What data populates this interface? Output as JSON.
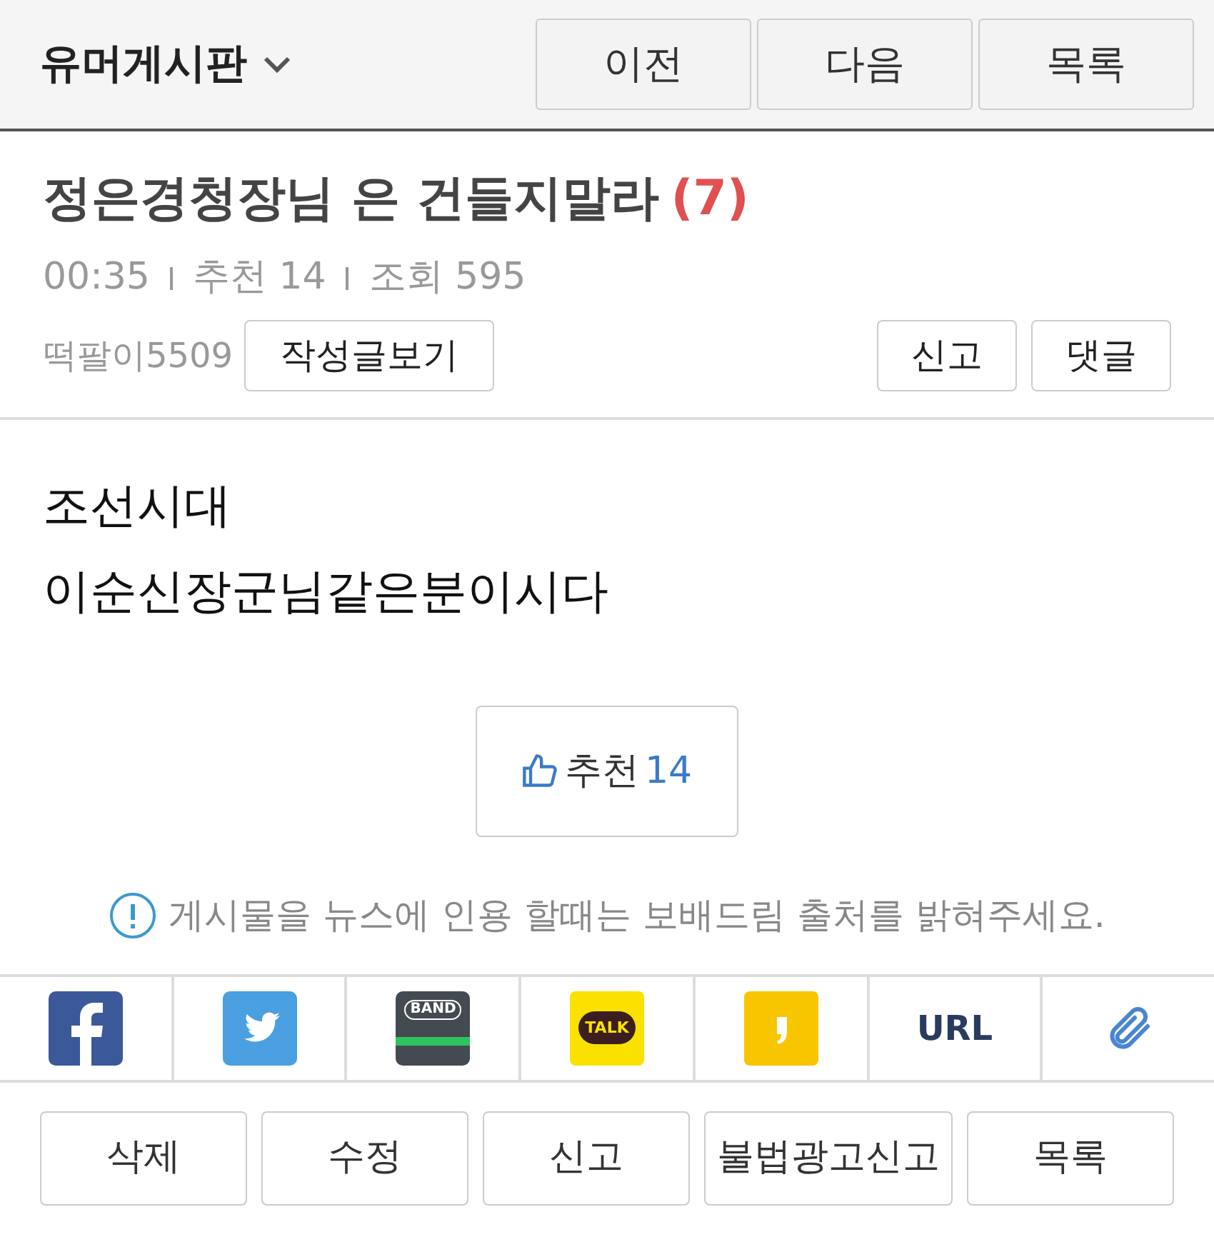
{
  "header": {
    "board": "유머게시판",
    "buttons": [
      "이전",
      "다음",
      "목록"
    ]
  },
  "post": {
    "title": "정은경청장님 은 건들지말라",
    "comment_count": "(7)",
    "time": "00:35",
    "recommend_label": "추천 14",
    "views_label": "조회 595",
    "author": "떡팔이5509",
    "author_button": "작성글보기",
    "actions": [
      "신고",
      "댓글"
    ]
  },
  "body": [
    "조선시대",
    "이순신장군님같은분이시다"
  ],
  "recommend_button": {
    "label": "추천",
    "count": "14"
  },
  "notice": "게시물을 뉴스에 인용 할때는 보배드림 출처를 밝혀주세요.",
  "share": [
    {
      "kind": "facebook"
    },
    {
      "kind": "twitter"
    },
    {
      "kind": "band",
      "label": "BAND"
    },
    {
      "kind": "talk",
      "label": "TALK"
    },
    {
      "kind": "story"
    },
    {
      "kind": "url",
      "label": "URL"
    },
    {
      "kind": "clip"
    }
  ],
  "bottom_buttons": [
    "삭제",
    "수정",
    "신고",
    "불법광고신고",
    "목록"
  ]
}
